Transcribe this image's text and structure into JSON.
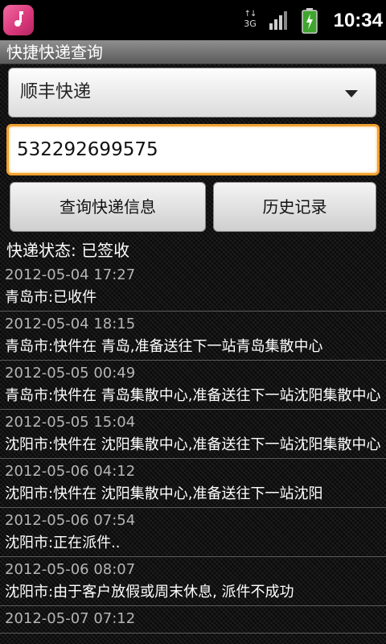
{
  "status_bar": {
    "network": "3G",
    "time": "10:34",
    "icons": [
      "app-icon",
      "network-3g-icon",
      "signal-icon",
      "battery-icon"
    ]
  },
  "title_bar": {
    "title": "快捷快递查询"
  },
  "courier_select": {
    "selected": "顺丰快递"
  },
  "tracking_input": {
    "value": "532292699575"
  },
  "buttons": {
    "query_label": "查询快递信息",
    "history_label": "历史记录"
  },
  "status": {
    "text": "快递状态: 已签收"
  },
  "tracking_events": [
    {
      "time": "2012-05-04 17:27",
      "desc": "青岛市:已收件"
    },
    {
      "time": "2012-05-04 18:15",
      "desc": "青岛市:快件在 青岛,准备送往下一站青岛集散中心"
    },
    {
      "time": "2012-05-05 00:49",
      "desc": "青岛市:快件在 青岛集散中心,准备送往下一站沈阳集散中心"
    },
    {
      "time": "2012-05-05 15:04",
      "desc": "沈阳市:快件在 沈阳集散中心,准备送往下一站沈阳集散中心"
    },
    {
      "time": "2012-05-06 04:12",
      "desc": "沈阳市:快件在 沈阳集散中心,准备送往下一站沈阳"
    },
    {
      "time": "2012-05-06 07:54",
      "desc": "沈阳市:正在派件.."
    },
    {
      "time": "2012-05-06 08:07",
      "desc": "沈阳市:由于客户放假或周末休息, 派件不成功"
    },
    {
      "time": "2012-05-07 07:12",
      "desc": ""
    }
  ]
}
